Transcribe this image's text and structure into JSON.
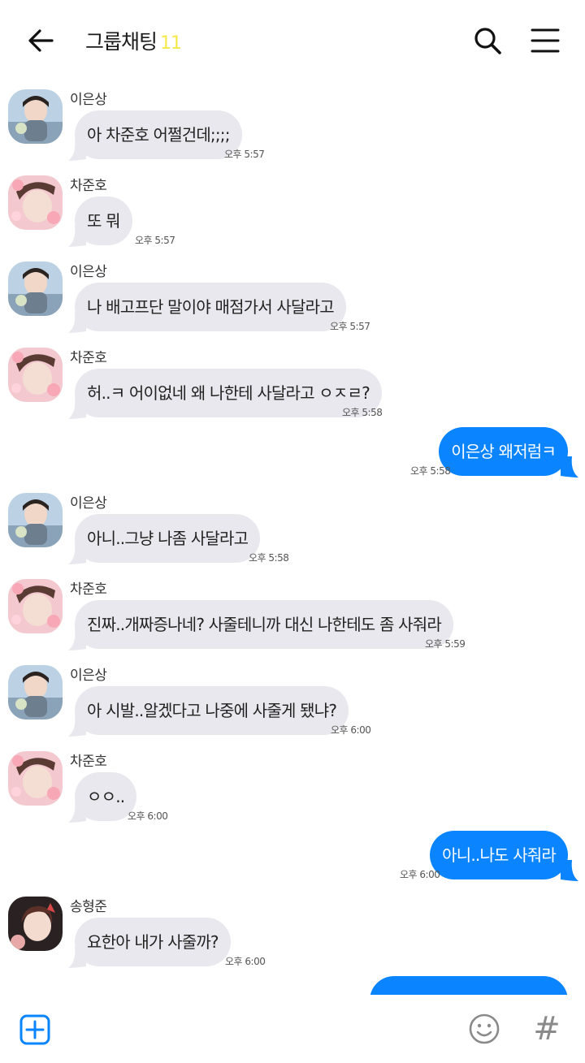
{
  "header": {
    "title": "그룹채팅",
    "count": "11",
    "back_icon": "arrow-left-icon",
    "search_icon": "search-icon",
    "menu_icon": "hamburger-menu-icon"
  },
  "messages": [
    {
      "sender": "이은상",
      "text": "아 차준호 어쩔건데;;;;",
      "time": "오후 5:57"
    },
    {
      "sender": "차준호",
      "text": "또 뭐",
      "time": "오후 5:57"
    },
    {
      "sender": "이은상",
      "text": "나 배고프단 말이야 매점가서 사달라고",
      "time": "오후 5:57"
    },
    {
      "sender": "차준호",
      "text": "허..ㅋ 어이없네 왜 나한테 사달라고 ㅇㅈㄹ?",
      "time": "오후 5:58"
    },
    {
      "sender": "",
      "text": "이은상 왜저럼ㅋ",
      "time": "오후 5:58"
    },
    {
      "sender": "이은상",
      "text": "아니..그냥 나좀 사달라고",
      "time": "오후 5:58"
    },
    {
      "sender": "차준호",
      "text": "진짜..개짜증나네? 사줄테니까 대신 나한테도 좀 사줘라",
      "time": "오후 5:59"
    },
    {
      "sender": "이은상",
      "text": "아 시발..알겠다고 나중에 사줄게 됐냐?",
      "time": "오후 6:00"
    },
    {
      "sender": "차준호",
      "text": "ㅇㅇ..",
      "time": "오후 6:00"
    },
    {
      "sender": "",
      "text": "아니..나도 사줘라",
      "time": "오후 6:00"
    },
    {
      "sender": "송형준",
      "text": "요한아 내가 사줄까?",
      "time": "오후 6:00"
    }
  ],
  "footer": {
    "plus_icon": "plus-square-icon",
    "emoji_icon": "smiley-icon",
    "hash_label": "#"
  },
  "colors": {
    "my_bubble": "#0a84ff",
    "other_bubble": "#e8e8ee",
    "title_count": "#f5e94a"
  }
}
